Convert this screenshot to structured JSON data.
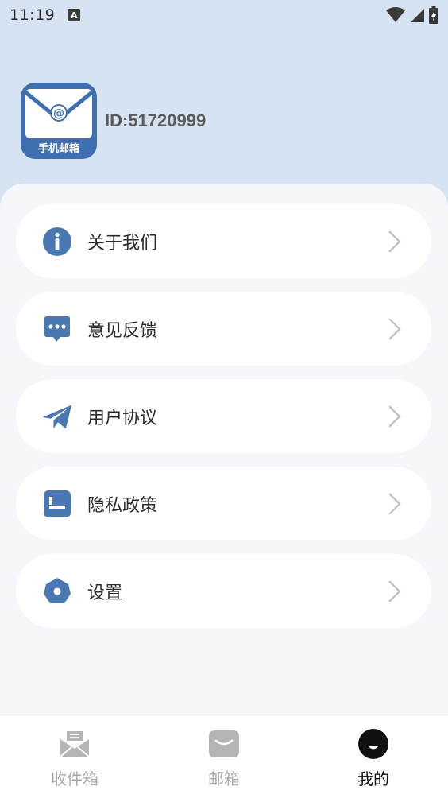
{
  "status_bar": {
    "time": "11:19",
    "notification_badge": "A"
  },
  "profile": {
    "logo_text": "手机邮箱",
    "user_id": "ID:51720999"
  },
  "menu": [
    {
      "label": "关于我们",
      "icon": "info-icon"
    },
    {
      "label": "意见反馈",
      "icon": "chat-bubble-icon"
    },
    {
      "label": "用户协议",
      "icon": "paper-plane-icon"
    },
    {
      "label": "隐私政策",
      "icon": "document-icon"
    },
    {
      "label": "设置",
      "icon": "settings-icon"
    }
  ],
  "tabs": [
    {
      "label": "收件箱",
      "icon": "inbox-icon",
      "active": false
    },
    {
      "label": "邮箱",
      "icon": "mail-icon",
      "active": false
    },
    {
      "label": "我的",
      "icon": "profile-icon",
      "active": true
    }
  ],
  "colors": {
    "accent": "#4a78b3",
    "header_bg": "#d5e3f3",
    "page_bg": "#f5f7fb"
  }
}
